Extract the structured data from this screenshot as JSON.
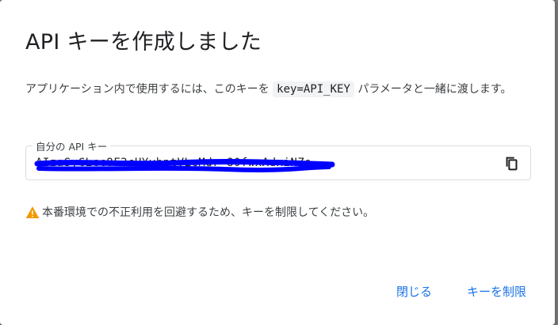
{
  "dialog": {
    "title": "API キーを作成しました",
    "description_before": "アプリケーション内で使用するには、このキーを",
    "description_code": "key=API_KEY",
    "description_after": "パラメータと一緒に渡します。",
    "field": {
      "label": "自分の API キー",
      "value": "AIzaSyCLcc8F2cHYvhptVLcMdr-80fwxAdxiNZo",
      "copy_icon": "copy-icon"
    },
    "warning": {
      "icon": "warning-icon",
      "text": "本番環境での不正利用を回避するため、キーを制限してください。",
      "icon_color": "#f29900"
    },
    "buttons": {
      "close": "閉じる",
      "restrict": "キーを制限"
    },
    "accent_color": "#1a73e8",
    "redaction_color": "#0000ff"
  }
}
